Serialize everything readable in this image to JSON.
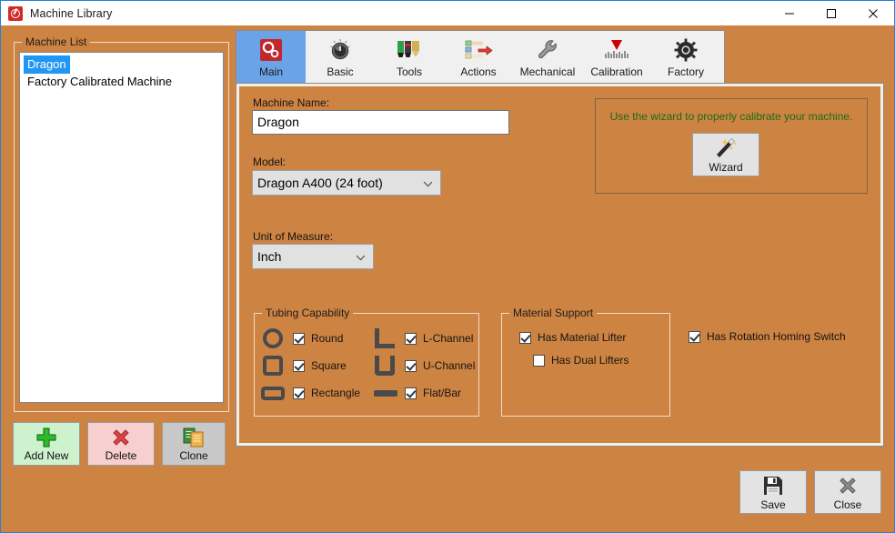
{
  "window": {
    "title": "Machine Library",
    "icon": "app-gauge-icon",
    "controls": {
      "minimize": "–",
      "maximize": "□",
      "close": "✕"
    },
    "background_color": "#cd8341",
    "border_color": "#2a7fd4"
  },
  "machine_list": {
    "group_title": "Machine List",
    "items": [
      {
        "label": "Dragon",
        "selected": true
      },
      {
        "label": "Factory Calibrated Machine",
        "selected": false
      }
    ],
    "selection_color": "#2196f3"
  },
  "list_actions": [
    {
      "label": "Add New",
      "icon": "plus-icon",
      "color": "#cdf2cd"
    },
    {
      "label": "Delete",
      "icon": "x-cross-icon",
      "color": "#f7cfcf"
    },
    {
      "label": "Clone",
      "icon": "copy-documents-icon",
      "color": "#c8c8c8"
    }
  ],
  "tabs": [
    {
      "label": "Main",
      "icon": "gears-red-icon",
      "active": true
    },
    {
      "label": "Basic",
      "icon": "knob-dial-icon",
      "active": false
    },
    {
      "label": "Tools",
      "icon": "markers-pens-icon",
      "active": false
    },
    {
      "label": "Actions",
      "icon": "actions-arrow-icon",
      "active": false
    },
    {
      "label": "Mechanical",
      "icon": "wrench-icon",
      "active": false
    },
    {
      "label": "Calibration",
      "icon": "caliper-gauge-icon",
      "active": false
    },
    {
      "label": "Factory",
      "icon": "gear-dark-icon",
      "active": false
    }
  ],
  "form": {
    "machine_name_label": "Machine Name:",
    "machine_name_value": "Dragon",
    "model_label": "Model:",
    "model_value": "Dragon A400 (24 foot)",
    "unit_label": "Unit of Measure:",
    "unit_value": "Inch"
  },
  "wizard": {
    "message": "Use the wizard to properly calibrate your machine.",
    "message_color": "#1b6b1b",
    "button_label": "Wizard",
    "button_icon": "magic-wand-icon"
  },
  "tubing": {
    "group_title": "Tubing Capability",
    "left_items": [
      {
        "label": "Round",
        "checked": true,
        "shape": "circle-shape-icon"
      },
      {
        "label": "Square",
        "checked": true,
        "shape": "square-shape-icon"
      },
      {
        "label": "Rectangle",
        "checked": true,
        "shape": "rectangle-shape-icon"
      }
    ],
    "right_items": [
      {
        "label": "L-Channel",
        "checked": true,
        "shape": "l-channel-shape-icon"
      },
      {
        "label": "U-Channel",
        "checked": true,
        "shape": "u-channel-shape-icon"
      },
      {
        "label": "Flat/Bar",
        "checked": true,
        "shape": "flat-bar-shape-icon"
      }
    ]
  },
  "material_support": {
    "group_title": "Material Support",
    "items": [
      {
        "label": "Has Material Lifter",
        "checked": true
      },
      {
        "label": "Has Dual Lifters",
        "checked": false
      }
    ]
  },
  "rotation": {
    "label": "Has Rotation Homing Switch",
    "checked": true
  },
  "footer_actions": [
    {
      "label": "Save",
      "icon": "floppy-disk-icon"
    },
    {
      "label": "Close",
      "icon": "x-cross-gray-icon"
    }
  ]
}
